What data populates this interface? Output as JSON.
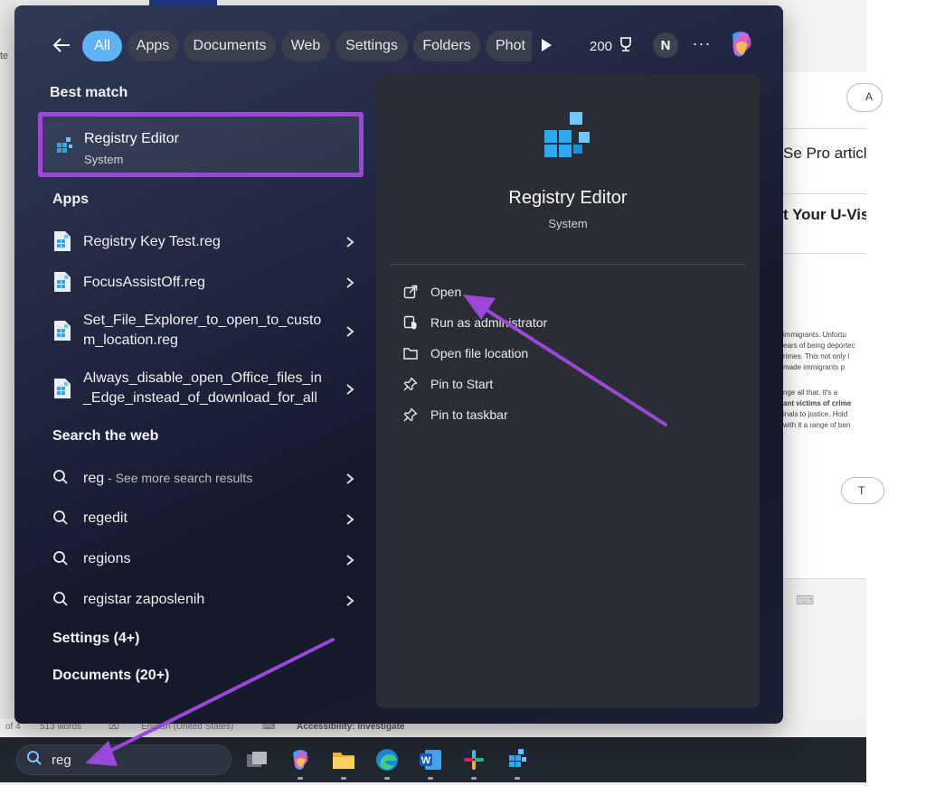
{
  "filter_bar": {
    "chips": [
      {
        "label": "All",
        "active": true
      },
      {
        "label": "Apps",
        "active": false
      },
      {
        "label": "Documents",
        "active": false
      },
      {
        "label": "Web",
        "active": false
      },
      {
        "label": "Settings",
        "active": false
      },
      {
        "label": "Folders",
        "active": false
      },
      {
        "label": "Phot",
        "active": false
      }
    ],
    "points": "200",
    "avatar_initial": "N",
    "more_label": "···"
  },
  "best_match": {
    "section_title": "Best match",
    "name": "Registry Editor",
    "subtitle": "System"
  },
  "apps": {
    "section_title": "Apps",
    "items": [
      {
        "label": "Registry Key Test.reg"
      },
      {
        "label": "FocusAssistOff.reg"
      },
      {
        "label_line1": "Set_File_Explorer_to_open_to_custo",
        "label_line2": "m_location.reg"
      },
      {
        "label_line1": "Always_disable_open_Office_files_in",
        "label_line2": "_Edge_instead_of_download_for_all"
      }
    ]
  },
  "web": {
    "section_title": "Search the web",
    "items": [
      {
        "label": "reg",
        "suffix": " - See more search results"
      },
      {
        "label": "regedit"
      },
      {
        "label": "regions"
      },
      {
        "label": "registar zaposlenih"
      }
    ]
  },
  "settings_section": {
    "title": "Settings (4+)"
  },
  "documents_section": {
    "title": "Documents (20+)"
  },
  "preview": {
    "title": "Registry Editor",
    "subtitle": "System",
    "actions": [
      {
        "label": "Open",
        "icon": "open-external-icon"
      },
      {
        "label": "Run as administrator",
        "icon": "shield-run-icon"
      },
      {
        "label": "Open file location",
        "icon": "folder-icon"
      },
      {
        "label": "Pin to Start",
        "icon": "pin-icon"
      },
      {
        "label": "Pin to taskbar",
        "icon": "pin-icon"
      }
    ]
  },
  "taskbar": {
    "search_value": "reg"
  },
  "background_document": {
    "heading_1": "Se Pro article",
    "heading_2": "t Your U-Visa",
    "body_lines": [
      "immigrants. Unfortu",
      "ears of being deportec",
      "rimes. This not only l",
      "made immigrants p",
      "",
      "nge all that. It's a",
      "ant victims of crime",
      "inals to justice. Hold",
      "with it a range of ben"
    ],
    "pill_top": "A",
    "pill_bottom": "T",
    "left_strip_text": "te",
    "status_page": "of 4",
    "status_words": "513 words",
    "status_language": "English (United States)",
    "status_accessibility": "Accessibility: Investigate"
  },
  "colors": {
    "accent_chip": "#5fb3f5",
    "highlight_box": "#9b48d8",
    "annotation_arrow": "#9b48d8"
  }
}
